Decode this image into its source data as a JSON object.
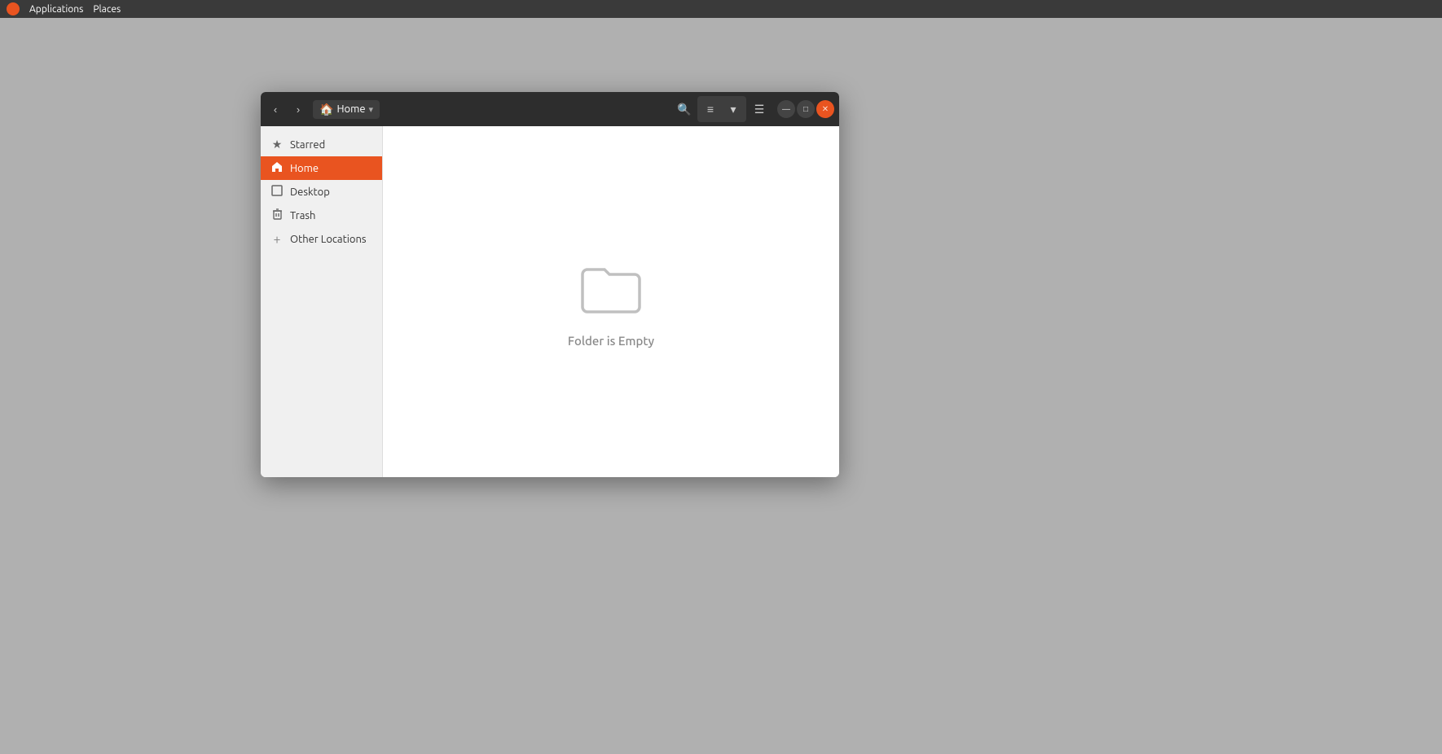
{
  "systembar": {
    "logo_alt": "Ubuntu logo",
    "items": [
      {
        "id": "applications",
        "label": "Applications"
      },
      {
        "id": "places",
        "label": "Places"
      }
    ]
  },
  "filemanager": {
    "titlebar": {
      "back_label": "‹",
      "forward_label": "›",
      "breadcrumb_icon": "🏠",
      "breadcrumb_label": "Home",
      "breadcrumb_dropdown": "▾",
      "search_icon": "🔍",
      "view_list_icon": "≡",
      "view_dropdown": "▾",
      "menu_icon": "☰",
      "minimize_label": "—",
      "maximize_label": "□",
      "close_label": "✕"
    },
    "sidebar": {
      "items": [
        {
          "id": "starred",
          "icon": "★",
          "label": "Starred",
          "active": false
        },
        {
          "id": "home",
          "icon": "🏠",
          "label": "Home",
          "active": true
        },
        {
          "id": "desktop",
          "icon": "□",
          "label": "Desktop",
          "active": false
        },
        {
          "id": "trash",
          "icon": "🗑",
          "label": "Trash",
          "active": false
        }
      ],
      "other_locations_label": "Other Locations"
    },
    "content": {
      "empty_icon_alt": "folder",
      "empty_text": "Folder is Empty"
    }
  },
  "colors": {
    "accent": "#e95420",
    "sidebar_bg": "#f0f0f0",
    "titlebar_bg": "#2d2d2d",
    "content_bg": "#ffffff"
  }
}
